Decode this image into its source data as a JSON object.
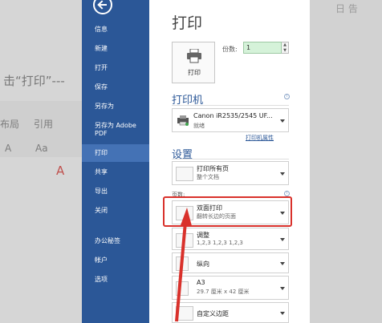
{
  "background": {
    "heading_fragment": "击“打印”---",
    "ribbon_layout": "布局",
    "ribbon_reference": "引用",
    "font_a": "A",
    "font_aa": "Aa",
    "red_a": "A",
    "top_right": "日 告"
  },
  "nav": {
    "items": [
      "信息",
      "新建",
      "打开",
      "保存",
      "另存为",
      "另存为 Adobe PDF",
      "打印",
      "共享",
      "导出",
      "关闭",
      "办公秘签",
      "帐户",
      "选项"
    ],
    "active": "打印"
  },
  "print": {
    "title": "打印",
    "print_button": "打印",
    "copies_label": "份数:",
    "copies_value": "1"
  },
  "printer": {
    "section": "打印机",
    "name": "Canon iR2535/2545 UF...",
    "status": "就绪",
    "properties_link": "打印机属性"
  },
  "settings": {
    "section": "设置",
    "print_all_main": "打印所有页",
    "print_all_sub": "整个文档",
    "pages_label": "页数:",
    "duplex_main": "双面打印",
    "duplex_sub": "翻转长边的页面",
    "collate_main": "调整",
    "collate_sub": "1,2,3    1,2,3    1,2,3",
    "orientation_main": "纵向",
    "paper_main": "A3",
    "paper_sub": "29.7 厘米 x 42 厘米",
    "margin_main": "自定义边距"
  },
  "colors": {
    "nav_bg": "#2b5797",
    "nav_active": "#4472b5",
    "accent": "#2b5797",
    "highlight": "#d9312b"
  }
}
